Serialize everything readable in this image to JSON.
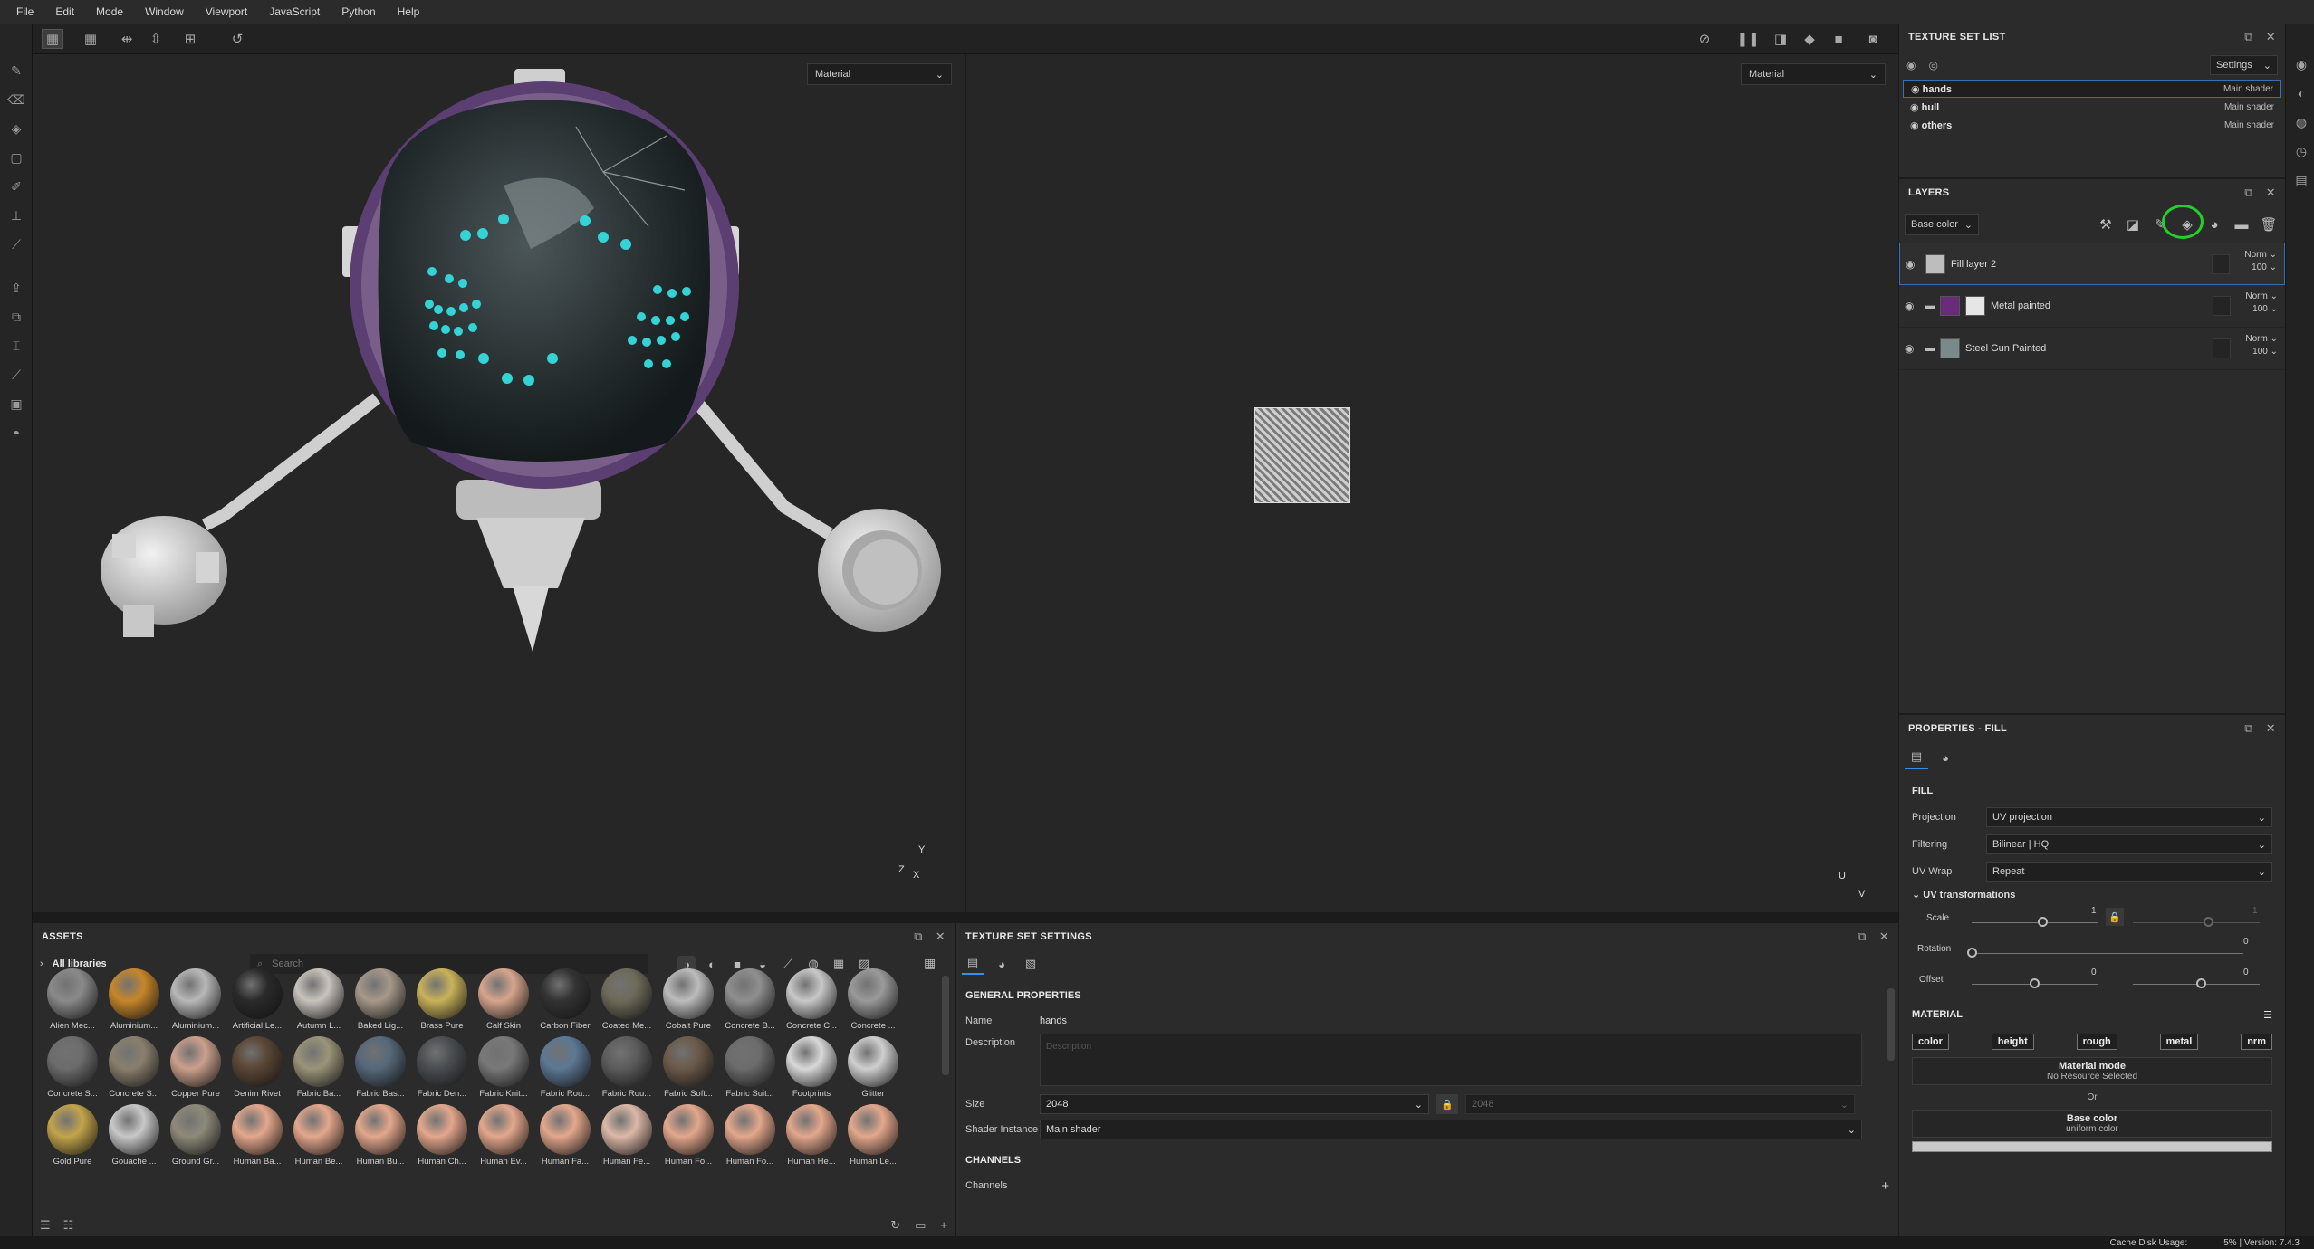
{
  "menu": [
    "File",
    "Edit",
    "Mode",
    "Window",
    "Viewport",
    "JavaScript",
    "Python",
    "Help"
  ],
  "viewport": {
    "left_mode": "Material",
    "right_mode": "Material",
    "axis_3d": [
      "Y",
      "Z",
      "X"
    ],
    "axis_uv": [
      "U",
      "V"
    ]
  },
  "texture_set_list": {
    "title": "TEXTURE SET LIST",
    "settings_label": "Settings",
    "items": [
      {
        "name": "hands",
        "shader": "Main shader",
        "selected": true
      },
      {
        "name": "hull",
        "shader": "Main shader",
        "selected": false
      },
      {
        "name": "others",
        "shader": "Main shader",
        "selected": false
      }
    ]
  },
  "layers": {
    "title": "LAYERS",
    "channel": "Base color",
    "items": [
      {
        "name": "Fill layer 2",
        "blend": "Norm",
        "opacity": "100",
        "selected": true
      },
      {
        "name": "Metal painted",
        "blend": "Norm",
        "opacity": "100",
        "selected": false
      },
      {
        "name": "Steel Gun Painted",
        "blend": "Norm",
        "opacity": "100",
        "selected": false
      }
    ]
  },
  "properties": {
    "title": "PROPERTIES - FILL",
    "section": "FILL",
    "projection_label": "Projection",
    "projection": "UV projection",
    "filtering_label": "Filtering",
    "filtering": "Bilinear | HQ",
    "uvwrap_label": "UV Wrap",
    "uvwrap": "Repeat",
    "uv_transformations": "UV transformations",
    "scale_label": "Scale",
    "scale_value": "1",
    "scale_value2": "1",
    "rotation_label": "Rotation",
    "rotation_value": "0",
    "offset_label": "Offset",
    "offset_value1": "0",
    "offset_value2": "0",
    "material_title": "MATERIAL",
    "material_buttons": [
      "color",
      "height",
      "rough",
      "metal",
      "nrm"
    ],
    "material_mode_title": "Material mode",
    "material_mode_sub": "No Resource Selected",
    "or_label": "Or",
    "base_color_title": "Base color",
    "base_color_sub": "uniform color"
  },
  "assets": {
    "title": "ASSETS",
    "libraries": "All libraries",
    "search_placeholder": "Search",
    "items": [
      {
        "label": "Alien Mec...",
        "color": "#8a8a8a"
      },
      {
        "label": "Aluminium...",
        "color": "#c7862a"
      },
      {
        "label": "Aluminium...",
        "color": "#b8b8b8"
      },
      {
        "label": "Artificial Le...",
        "color": "#2a2a2a"
      },
      {
        "label": "Autumn L...",
        "color": "#c9c3bd"
      },
      {
        "label": "Baked Lig...",
        "color": "#a6988a"
      },
      {
        "label": "Brass Pure",
        "color": "#c9b25a"
      },
      {
        "label": "Calf Skin",
        "color": "#d6a58d"
      },
      {
        "label": "Carbon Fiber",
        "color": "#333333"
      },
      {
        "label": "Coated Me...",
        "color": "#6e6a5a"
      },
      {
        "label": "Cobalt Pure",
        "color": "#bcbcbc"
      },
      {
        "label": "Concrete B...",
        "color": "#8f8f8f"
      },
      {
        "label": "Concrete C...",
        "color": "#c8c8c8"
      },
      {
        "label": "Concrete ...",
        "color": "#9a9a9a"
      },
      {
        "label": "Concrete S...",
        "color": "#6c6c6c"
      },
      {
        "label": "Concrete S...",
        "color": "#8a7f6e"
      },
      {
        "label": "Copper Pure",
        "color": "#caa08c"
      },
      {
        "label": "Denim Rivet",
        "color": "#5a4634"
      },
      {
        "label": "Fabric Ba...",
        "color": "#9a9478"
      },
      {
        "label": "Fabric Bas...",
        "color": "#56687a"
      },
      {
        "label": "Fabric Den...",
        "color": "#4a4e52"
      },
      {
        "label": "Fabric Knit...",
        "color": "#787878"
      },
      {
        "label": "Fabric Rou...",
        "color": "#5c7894"
      },
      {
        "label": "Fabric Rou...",
        "color": "#5c5c5c"
      },
      {
        "label": "Fabric Soft...",
        "color": "#6b5a4a"
      },
      {
        "label": "Fabric Suit...",
        "color": "#6c6c6c"
      },
      {
        "label": "Footprints",
        "color": "#d8d8d8"
      },
      {
        "label": "Glitter",
        "color": "#cfcfcf"
      },
      {
        "label": "Gold Pure",
        "color": "#c2a44a"
      },
      {
        "label": "Gouache ...",
        "color": "#c8c8c8"
      },
      {
        "label": "Ground Gr...",
        "color": "#8e8a7a"
      },
      {
        "label": "Human Ba...",
        "color": "#e3a78c"
      },
      {
        "label": "Human Be...",
        "color": "#e3a78c"
      },
      {
        "label": "Human Bu...",
        "color": "#e3a78c"
      },
      {
        "label": "Human Ch...",
        "color": "#e3a78c"
      },
      {
        "label": "Human Ev...",
        "color": "#e3a78c"
      },
      {
        "label": "Human Fa...",
        "color": "#e3a78c"
      },
      {
        "label": "Human Fe...",
        "color": "#dcb8a8"
      },
      {
        "label": "Human Fo...",
        "color": "#e3a78c"
      },
      {
        "label": "Human Fo...",
        "color": "#e3a78c"
      },
      {
        "label": "Human He...",
        "color": "#e3a78c"
      },
      {
        "label": "Human Le...",
        "color": "#e3a78c"
      }
    ]
  },
  "texture_set_settings": {
    "title": "TEXTURE SET SETTINGS",
    "general_title": "GENERAL PROPERTIES",
    "name_label": "Name",
    "name_value": "hands",
    "description_label": "Description",
    "description_placeholder": "Description",
    "size_label": "Size",
    "size_value": "2048",
    "size_value2": "2048",
    "shader_label": "Shader Instance",
    "shader_value": "Main shader",
    "channels_title": "CHANNELS",
    "channels_label": "Channels"
  },
  "status": {
    "cache": "Cache Disk Usage:",
    "usage": "5% | Version: 7.4.3"
  },
  "colors": {
    "accent": "#3a8ee6",
    "highlight_circle": "#21d12a",
    "panel": "#2b2b2b",
    "viewport": "#262626"
  }
}
